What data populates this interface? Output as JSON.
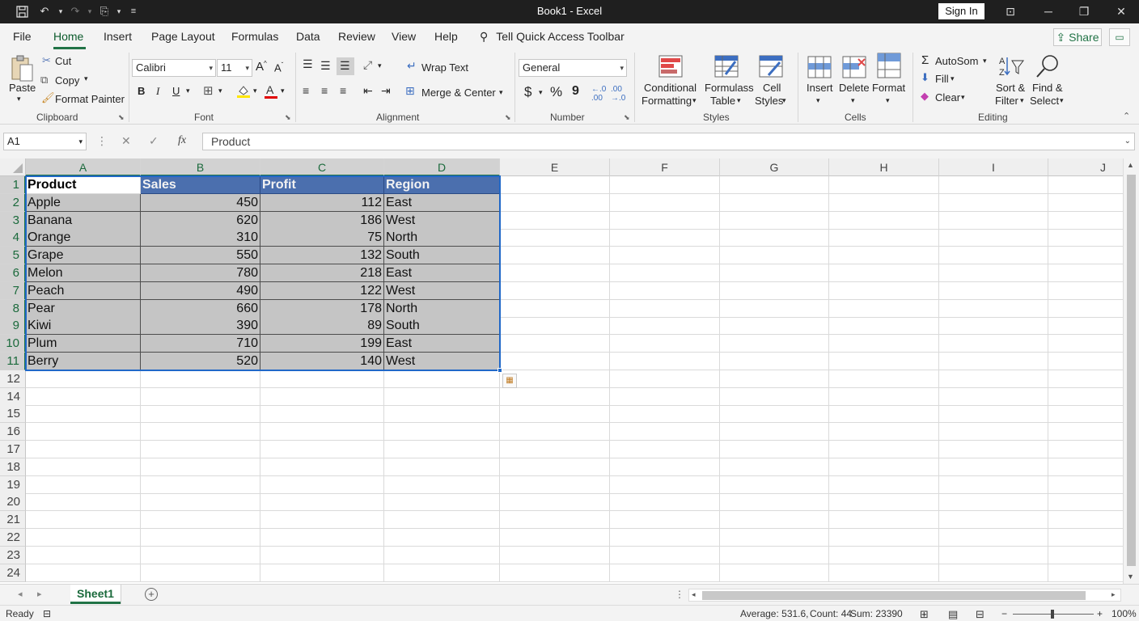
{
  "window": {
    "title": "Book1  -  Excel",
    "sign_in": "Sign In"
  },
  "menu": {
    "items": [
      "File",
      "Home",
      "Insert",
      "Page Layout",
      "Formulas",
      "Data",
      "Review",
      "View",
      "Help"
    ],
    "active": "Home",
    "tell_me": "Tell Quick Access Toolbar",
    "share": "Share"
  },
  "ribbon": {
    "clipboard": {
      "label": "Clipboard",
      "paste": "Paste",
      "cut": "Cut",
      "copy": "Copy",
      "format_painter": "Format Painter"
    },
    "font": {
      "label": "Font",
      "name": "Calibri",
      "size": "11",
      "bold": "B",
      "italic": "I",
      "underline": "U"
    },
    "alignment": {
      "label": "Alignment",
      "wrap_text": "Wrap Text",
      "merge_center": "Merge & Center"
    },
    "number": {
      "label": "Number",
      "format": "General",
      "currency": "$",
      "percent": "%",
      "comma": "9"
    },
    "styles": {
      "label": "Styles",
      "conditional_1": "Conditional",
      "conditional_2": "Formatting",
      "format_as_1": "Formulass",
      "format_as_2": "Table",
      "cell_styles_1": "Cell",
      "cell_styles_2": "Styles"
    },
    "cells": {
      "label": "Cells",
      "insert": "Insert",
      "delete": "Delete",
      "format": "Format"
    },
    "editing": {
      "label": "Editing",
      "autosum": "AutoSom",
      "fill": "Fill",
      "clear": "Clear",
      "sort_1": "Sort &",
      "sort_2": "Filter",
      "find_1": "Find &",
      "find_2": "Select"
    }
  },
  "formula_bar": {
    "name_box": "A1",
    "fx": "fx",
    "content": "Product"
  },
  "sheet": {
    "columns": [
      "A",
      "B",
      "C",
      "D",
      "E",
      "F",
      "G",
      "H",
      "I",
      "J"
    ],
    "rows": [
      "1",
      "2",
      "3",
      "4",
      "5",
      "6",
      "7",
      "8",
      "9",
      "10",
      "11",
      "12",
      "14",
      "15",
      "16",
      "17",
      "18",
      "19",
      "20",
      "21",
      "22",
      "23",
      "24"
    ],
    "table": {
      "headers": [
        "Product",
        "Sales",
        "Profit",
        "Region"
      ],
      "rows": [
        [
          "Apple",
          "450",
          "112",
          "East"
        ],
        [
          "Banana",
          "620",
          "186",
          "West"
        ],
        [
          "Orange",
          "310",
          "75",
          "North"
        ],
        [
          "Grape",
          "550",
          "132",
          "South"
        ],
        [
          "Melon",
          "780",
          "218",
          "East"
        ],
        [
          "Peach",
          "490",
          "122",
          "West"
        ],
        [
          "Pear",
          "660",
          "178",
          "North"
        ],
        [
          "Kiwi",
          "390",
          "89",
          "South"
        ],
        [
          "Plum",
          "710",
          "199",
          "East"
        ],
        [
          "Berry",
          "520",
          "140",
          "West"
        ]
      ]
    }
  },
  "tabs": {
    "sheets": [
      "Sheet1"
    ]
  },
  "status": {
    "mode": "Ready",
    "average": "Average: 531.6,",
    "count": "Count: 44",
    "sum": "Sum: 23390",
    "zoom": "100%"
  },
  "colors": {
    "accent": "#217346",
    "header_fill": "#4b6fae",
    "data_fill": "#c5c5c5",
    "selection": "#2068c8"
  }
}
